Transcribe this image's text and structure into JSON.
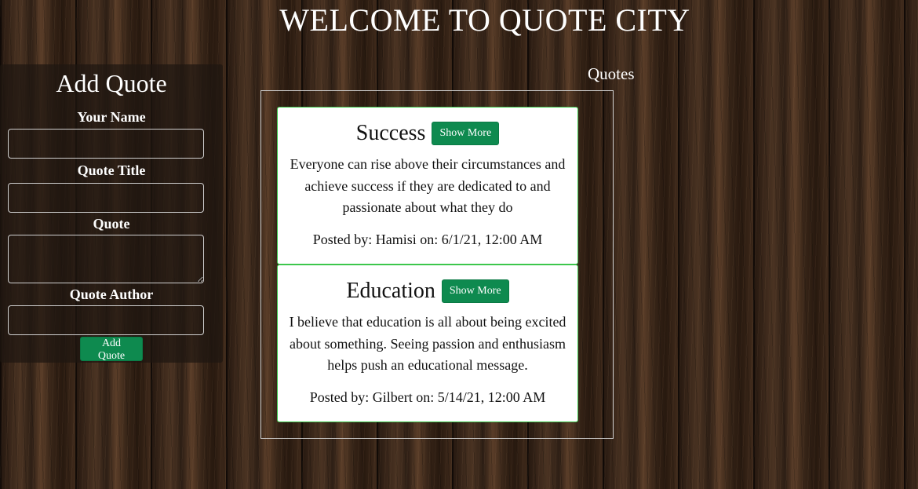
{
  "header": {
    "title": "WELCOME TO QUOTE CITY"
  },
  "form": {
    "title": "Add Quote",
    "name_label": "Your Name",
    "name_value": "",
    "quote_title_label": "Quote Title",
    "quote_title_value": "",
    "quote_label": "Quote",
    "quote_value": "",
    "author_label": "Quote Author",
    "author_value": "",
    "submit_label": "Add Quote"
  },
  "quotes": {
    "heading": "Quotes",
    "items": [
      {
        "title": "Success",
        "button": "Show More",
        "text": "Everyone can rise above their circumstances and achieve success if they are dedicated to and passionate about what they do",
        "meta": "Posted by: Hamisi on: 6/1/21, 12:00 AM"
      },
      {
        "title": "Education",
        "button": "Show More",
        "text": "I believe that education is all about being excited about something. Seeing passion and enthusiasm helps push an educational message.",
        "meta": "Posted by: Gilbert on: 5/14/21, 12:00 AM"
      }
    ]
  },
  "colors": {
    "button": "#0e8a4f",
    "card_border": "#3cc74c",
    "panel": "#1e1611"
  }
}
